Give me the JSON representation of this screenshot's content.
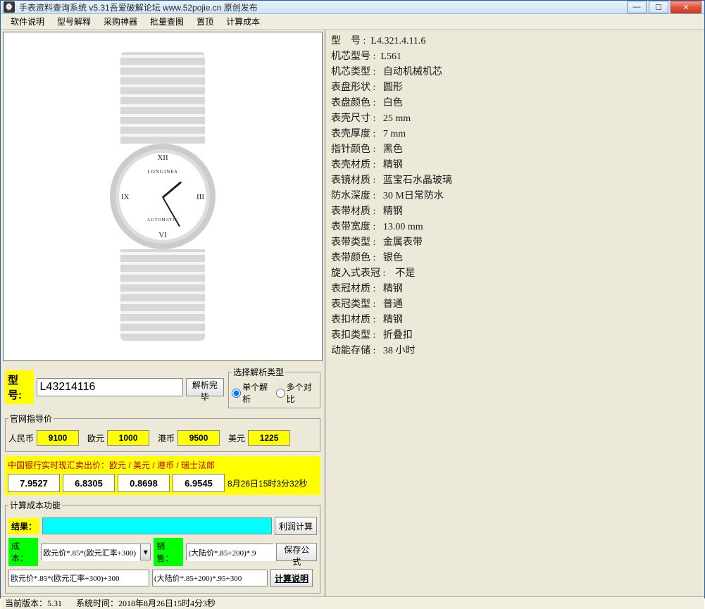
{
  "window": {
    "title": "手表资料查询系统 v5.31吾爱破解论坛 www.52pojie.cn 原创发布"
  },
  "menu": [
    "软件说明",
    "型号解释",
    "采购神器",
    "批量查图",
    "置顶",
    "计算成本"
  ],
  "model_input": {
    "label": "型号:",
    "value": "L43214116",
    "parse_button": "解析完毕"
  },
  "parse_type": {
    "legend": "选择解析类型",
    "opt_single": "单个解析",
    "opt_multi": "多个对比"
  },
  "official_price": {
    "legend": "官网指导价",
    "rmb_label": "人民币",
    "rmb": "9100",
    "eur_label": "欧元",
    "eur": "1000",
    "hkd_label": "港币",
    "hkd": "9500",
    "usd_label": "美元",
    "usd": "1225"
  },
  "fx": {
    "title": "中国银行实时现汇卖出价：欧元 / 美元 / 港币 / 瑞士法郎",
    "eur": "7.9527",
    "usd": "6.8305",
    "hkd": "0.8698",
    "chf": "6.9545",
    "time": "8月26日15时3分32秒"
  },
  "cost": {
    "legend": "计算成本功能",
    "result_label": "结果：",
    "profit_button": "利润计算",
    "cost_label": "成本：",
    "cost_formula_short": "欧元价*.85*(欧元汇率+300)",
    "sale_label": "销售：",
    "sale_formula_short": "(大陆价*.85+200)*.9",
    "save_button": "保存公式",
    "cost_formula_full": "欧元价*.85*(欧元汇率+300)+300",
    "sale_formula_full": "(大陆价*.85+200)*.95+300",
    "explain_button": "计算说明"
  },
  "specs": [
    [
      "型    号",
      "L4.321.4.11.6"
    ],
    [
      "机芯型号",
      "L561"
    ],
    [
      "机芯类型",
      " 自动机械机芯"
    ],
    [
      "表盘形状",
      " 圆形"
    ],
    [
      "表盘颜色",
      " 白色"
    ],
    [
      "表壳尺寸",
      " 25 mm"
    ],
    [
      "表壳厚度",
      " 7 mm"
    ],
    [
      "指针颜色",
      " 黑色"
    ],
    [
      "表壳材质",
      " 精钢"
    ],
    [
      "表镜材质",
      " 蓝宝石水晶玻璃"
    ],
    [
      "防水深度",
      " 30 M日常防水"
    ],
    [
      "表带材质",
      " 精钢"
    ],
    [
      "表带宽度",
      " 13.00 mm"
    ],
    [
      "表带类型",
      " 金属表带"
    ],
    [
      "表带颜色",
      " 银色"
    ],
    [
      "旋入式表冠",
      "  不是"
    ],
    [
      "表冠材质",
      " 精钢"
    ],
    [
      "表冠类型",
      " 普通"
    ],
    [
      "表扣材质",
      " 精钢"
    ],
    [
      "表扣类型",
      " 折叠扣"
    ],
    [
      "动能存储",
      " 38 小时"
    ]
  ],
  "status": {
    "version_label": "当前版本：",
    "version": "5.31",
    "systime_label": "系统时间：",
    "systime": "2018年8月26日15时4分3秒"
  },
  "watch_face": {
    "brand": "LONGINES",
    "auto": "AUTOMATIC"
  }
}
